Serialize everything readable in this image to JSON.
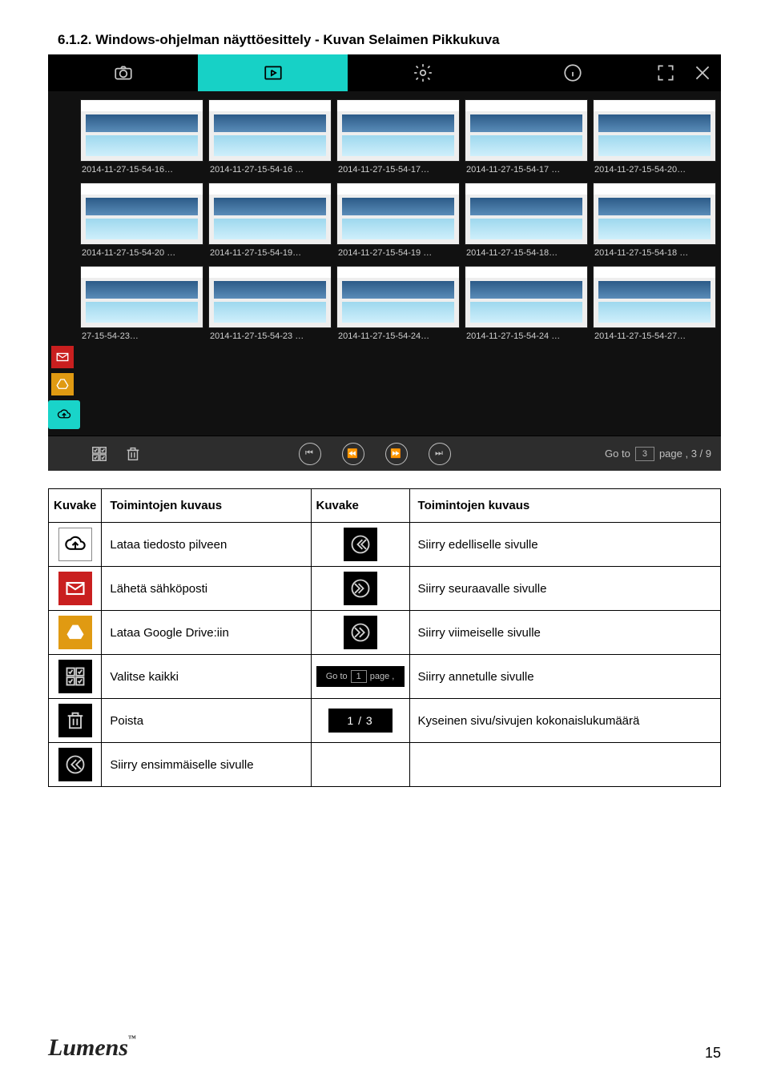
{
  "section_title": "6.1.2. Windows-ohjelman näyttöesittely - Kuvan Selaimen Pikkukuva",
  "screenshot": {
    "thumbnails": [
      "2014-11-27-15-54-16…",
      "2014-11-27-15-54-16 …",
      "2014-11-27-15-54-17…",
      "2014-11-27-15-54-17 …",
      "2014-11-27-15-54-20…",
      "2014-11-27-15-54-20 …",
      "2014-11-27-15-54-19…",
      "2014-11-27-15-54-19 …",
      "2014-11-27-15-54-18…",
      "2014-11-27-15-54-18 …",
      "27-15-54-23…",
      "2014-11-27-15-54-23 …",
      "2014-11-27-15-54-24…",
      "2014-11-27-15-54-24 …",
      "2014-11-27-15-54-27…"
    ],
    "goto_label": "Go to",
    "goto_value": "3",
    "goto_suffix": "page ,  3  /  9"
  },
  "table": {
    "headers": [
      "Kuvake",
      "Toimintojen kuvaus",
      "Kuvake",
      "Toimintojen kuvaus"
    ],
    "rows": [
      {
        "l": "Lataa tiedosto pilveen",
        "r": "Siirry edelliselle sivulle"
      },
      {
        "l": "Lähetä sähköposti",
        "r": "Siirry seuraavalle sivulle"
      },
      {
        "l": "Lataa Google Drive:iin",
        "r": "Siirry viimeiselle sivulle"
      },
      {
        "l": "Valitse kaikki",
        "r": "Siirry annetulle sivulle"
      },
      {
        "l": "Poista",
        "r": "Kyseinen sivu/sivujen kokonaislukumäärä"
      },
      {
        "l": "Siirry ensimmäiselle sivulle",
        "r": ""
      }
    ],
    "goto_inline": {
      "label": "Go to",
      "value": "1",
      "suffix": "page ,"
    },
    "page_indicator": "1 / 3"
  },
  "footer": {
    "logo": "Lumens",
    "page": "15"
  }
}
